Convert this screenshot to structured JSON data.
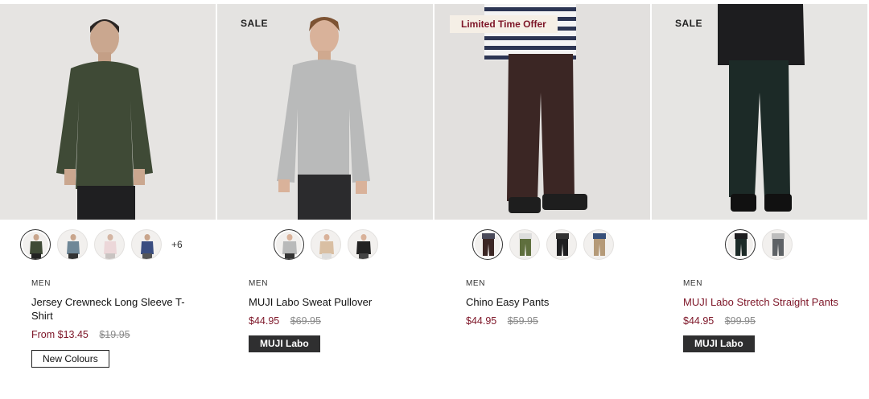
{
  "colors": {
    "sale_red": "#7d1527",
    "offer_bg": "#f5efe6",
    "tag_dark": "#2f2f30"
  },
  "products": [
    {
      "category": "MEN",
      "name": "Jersey Crewneck Long Sleeve T-Shirt",
      "price_now": "From $13.45",
      "price_was": "$19.95",
      "badge": "",
      "tag": "New Colours",
      "more_colors": "+6",
      "swatch_icons": [
        "olive-tee-icon",
        "blue-grey-tee-icon",
        "pink-tee-icon",
        "navy-tee-icon"
      ]
    },
    {
      "category": "MEN",
      "name": "MUJI Labo Sweat Pullover",
      "price_now": "$44.95",
      "price_was": "$69.95",
      "badge": "SALE",
      "tag": "MUJI Labo",
      "swatch_icons": [
        "grey-sweater-icon",
        "beige-sweater-icon",
        "black-sweater-icon"
      ]
    },
    {
      "category": "MEN",
      "name": "Chino Easy Pants",
      "price_now": "$44.95",
      "price_was": "$59.95",
      "badge": "Limited Time Offer",
      "tag": "",
      "swatch_icons": [
        "brown-pants-icon",
        "khaki-pants-icon",
        "black-pants-icon",
        "beige-pants-icon"
      ]
    },
    {
      "category": "MEN",
      "name": "MUJI Labo Stretch Straight Pants",
      "price_now": "$44.95",
      "price_was": "$99.95",
      "badge": "SALE",
      "tag": "MUJI Labo",
      "swatch_icons": [
        "black-pants-icon",
        "grey-pants-icon"
      ]
    }
  ]
}
